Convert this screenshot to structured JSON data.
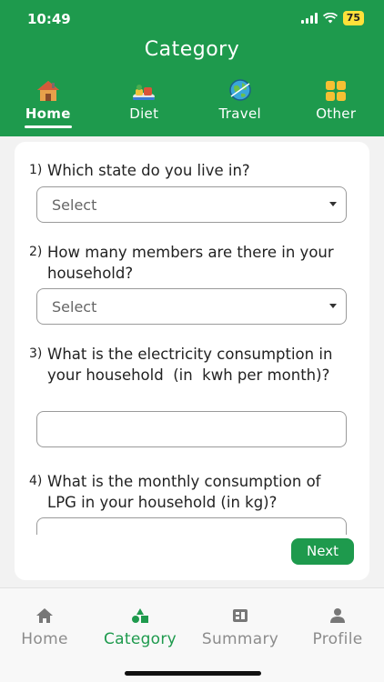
{
  "status_bar": {
    "time": "10:49",
    "battery": "75"
  },
  "header": {
    "title": "Category"
  },
  "category_tabs": [
    {
      "label": "Home",
      "icon": "house-icon",
      "active": true
    },
    {
      "label": "Diet",
      "icon": "food-plate-icon",
      "active": false
    },
    {
      "label": "Travel",
      "icon": "globe-travel-icon",
      "active": false
    },
    {
      "label": "Other",
      "icon": "grid-squares-icon",
      "active": false
    }
  ],
  "questions": [
    {
      "num": "1)",
      "text": "Which state do you live in?",
      "type": "select",
      "value": "Select"
    },
    {
      "num": "2)",
      "text": "How many members are there in your household?",
      "type": "select",
      "value": "Select"
    },
    {
      "num": "3)",
      "text": "What is the electricity consumption in your household  (in  kwh per month)?",
      "type": "text",
      "value": ""
    },
    {
      "num": "4)",
      "text": "What is the monthly consumption of LPG in your household (in kg)?",
      "type": "text",
      "value": ""
    }
  ],
  "next_label": "Next",
  "bottom_nav": [
    {
      "label": "Home",
      "icon": "home-icon",
      "active": false
    },
    {
      "label": "Category",
      "icon": "shapes-icon",
      "active": true
    },
    {
      "label": "Summary",
      "icon": "summary-icon",
      "active": false
    },
    {
      "label": "Profile",
      "icon": "person-icon",
      "active": false
    }
  ],
  "colors": {
    "brand_green": "#1e9a4d",
    "battery_yellow": "#ffe13a",
    "inactive_gray": "#8c8c8c"
  }
}
